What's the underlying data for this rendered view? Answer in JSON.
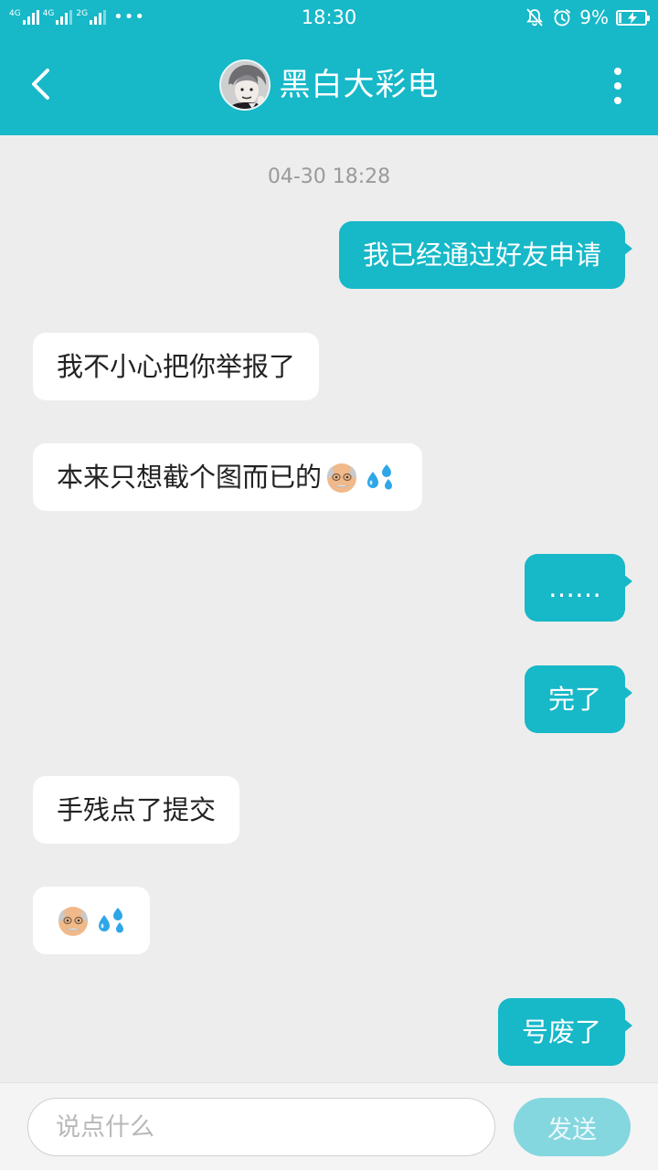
{
  "status_bar": {
    "sim1_label": "4G",
    "sim1_sub_label": "4G",
    "sim2_label": "2G",
    "more_dots": "•••",
    "time": "18:30",
    "battery_percent": "9%",
    "icons": [
      "mute-bell-icon",
      "alarm-clock-icon",
      "battery-charging-icon"
    ]
  },
  "header": {
    "back_icon": "chevron-left-icon",
    "title": "黑白大彩电",
    "more_icon": "more-vertical-icon"
  },
  "chat": {
    "timestamp": "04-30 18:28",
    "messages": [
      {
        "side": "out",
        "text": "我已经通过好友申请"
      },
      {
        "side": "in",
        "text": "我不小心把你举报了"
      },
      {
        "side": "in",
        "text": "本来只想截个图而已的",
        "emojis": [
          "old-man-emoji",
          "sweat-droplets-emoji"
        ]
      },
      {
        "side": "out",
        "text": "……"
      },
      {
        "side": "out",
        "text": "完了"
      },
      {
        "side": "in",
        "text": "手残点了提交"
      },
      {
        "side": "in",
        "text": "",
        "emojis": [
          "old-man-emoji",
          "sweat-droplets-emoji"
        ]
      },
      {
        "side": "out",
        "text": "号废了"
      }
    ]
  },
  "input_bar": {
    "placeholder": "说点什么",
    "send_label": "发送"
  },
  "colors": {
    "brand": "#17b8c8",
    "chat_background": "#ededed",
    "incoming_bubble": "#ffffff",
    "send_disabled": "#85d7df"
  }
}
